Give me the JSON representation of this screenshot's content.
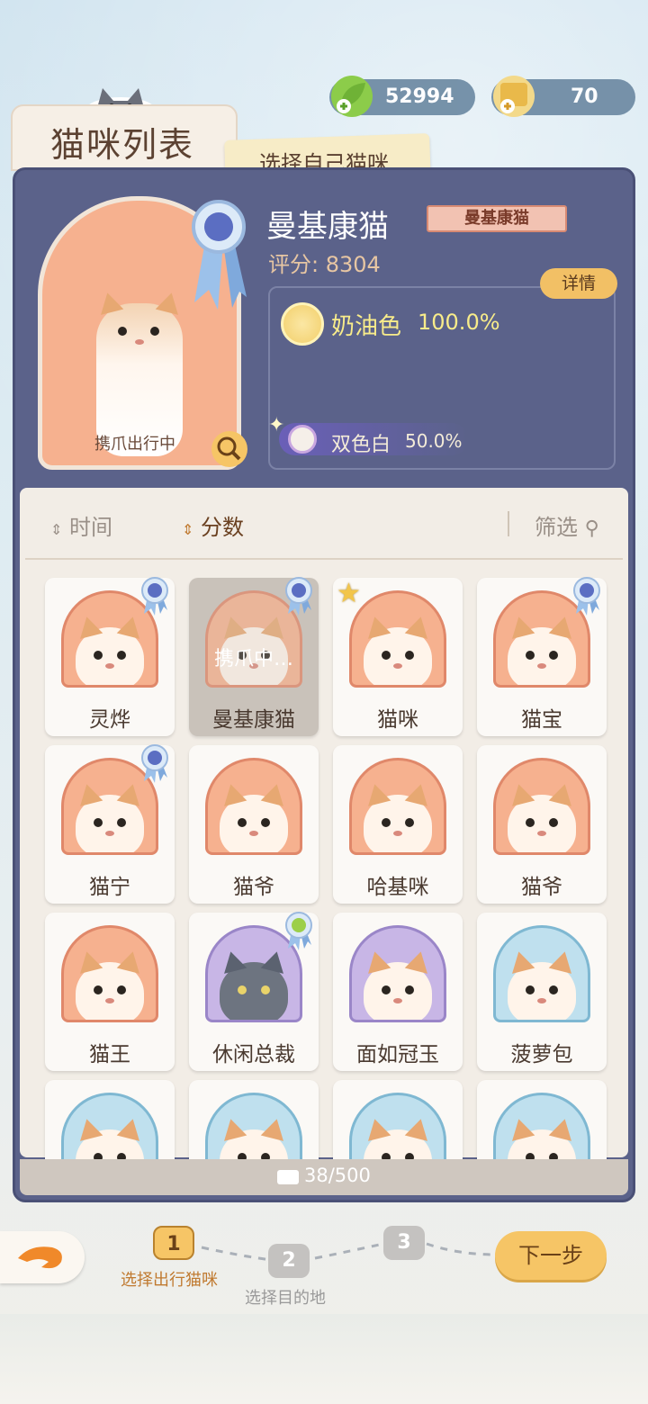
{
  "currency": {
    "leaf_amount": "52994",
    "ticket_amount": "70"
  },
  "header": {
    "title": "猫咪列表",
    "hint": "选择自己猫咪"
  },
  "selected_cat": {
    "name": "曼基康猫",
    "breed": "曼基康猫",
    "score": "评分: 8304",
    "status": "携爪出行中",
    "detail_label": "详情",
    "genes": [
      {
        "name": "奶油色",
        "percent": "100.0%"
      },
      {
        "name": "双色白",
        "percent": "50.0%"
      }
    ]
  },
  "sort": {
    "time_label": "时间",
    "score_label": "分数",
    "filter_label": "筛选"
  },
  "cats": [
    {
      "name": "灵烨"
    },
    {
      "name": "曼基康猫",
      "overlay": "携爪中…"
    },
    {
      "name": "猫咪"
    },
    {
      "name": "猫宝"
    },
    {
      "name": "猫宁"
    },
    {
      "name": "猫爷"
    },
    {
      "name": "哈基咪"
    },
    {
      "name": "猫爷"
    },
    {
      "name": "猫王"
    },
    {
      "name": "休闲总裁"
    },
    {
      "name": "面如冠玉"
    },
    {
      "name": "菠萝包"
    }
  ],
  "capacity": "38/500",
  "steps": {
    "step1_num": "1",
    "step1_label": "选择出行猫咪",
    "step2_num": "2",
    "step2_label": "选择目的地",
    "step3_num": "3"
  },
  "next_label": "下一步",
  "colors": {
    "panel": "#5b628a",
    "accent_orange": "#f6b18f",
    "button_yellow": "#f6c566"
  }
}
